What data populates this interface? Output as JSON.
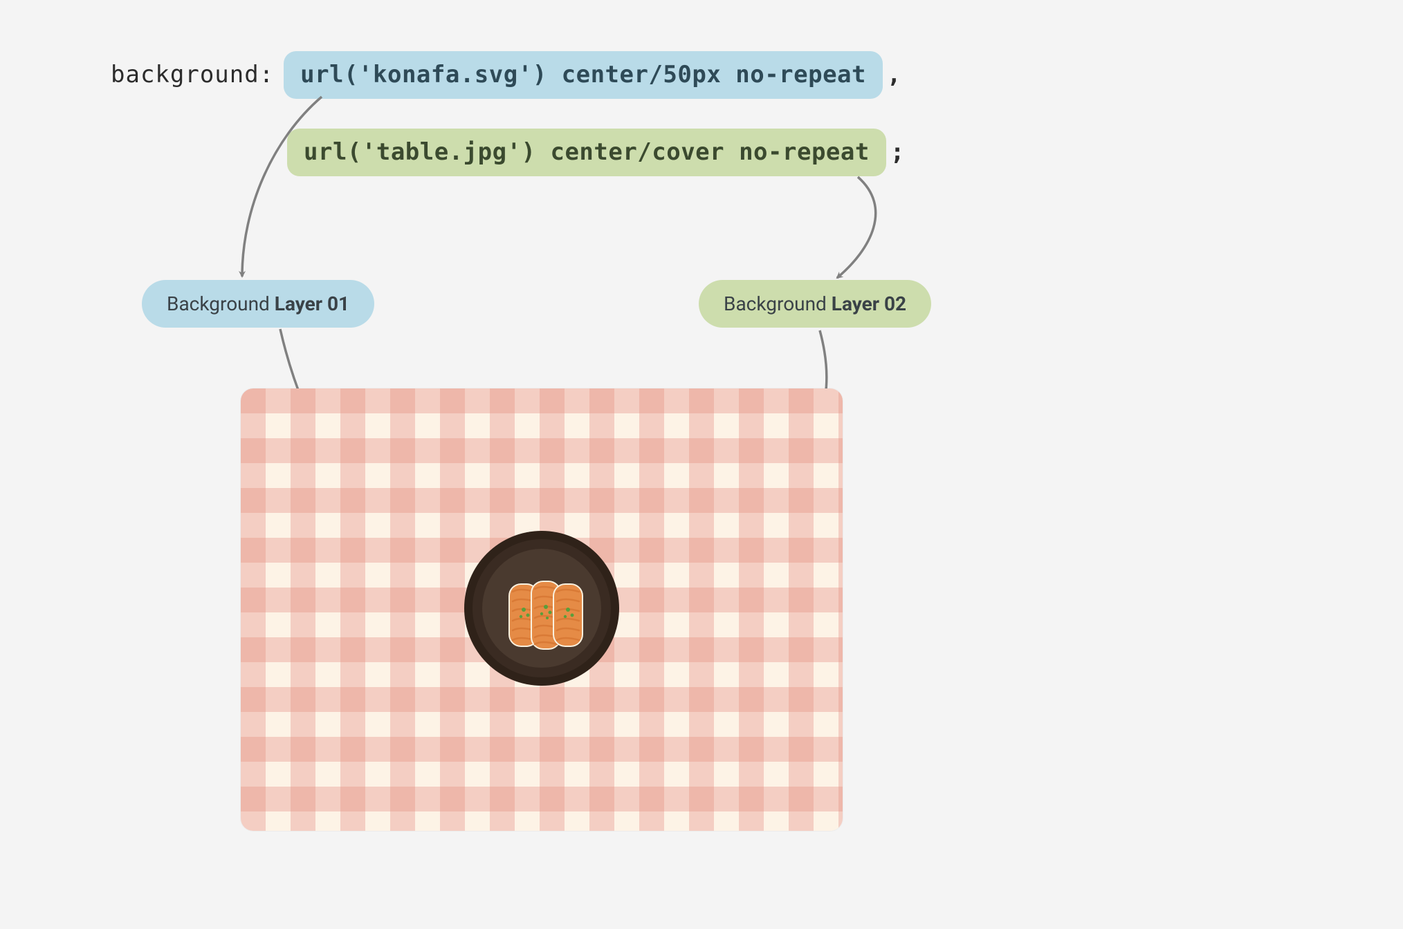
{
  "code": {
    "property": "background:",
    "layer1_value": "url('konafa.svg') center/50px no-repeat",
    "layer1_suffix": ",",
    "layer2_value": "url('table.jpg') center/cover no-repeat",
    "layer2_suffix": ";"
  },
  "labels": {
    "layer1_prefix": "Background ",
    "layer1_bold": "Layer 01",
    "layer2_prefix": "Background ",
    "layer2_bold": "Layer 02"
  },
  "colors": {
    "blue_pill": "#b9dbe8",
    "green_pill": "#cdddad",
    "text_dark": "#344652",
    "page_bg": "#f4f4f4",
    "arrow": "#808080",
    "tablecloth_light": "#fdf3e6",
    "tablecloth_pink_light": "#f4cec3",
    "tablecloth_pink_dark": "#eeb7aa",
    "plate_outer": "#3a2b22",
    "plate_inner": "#4a3a2f",
    "konafa": "#e58b46",
    "konafa_stripe": "#d97a36",
    "garnish": "#5a9e3b"
  },
  "diagram": {
    "layer1_asset": "konafa.svg",
    "layer2_asset": "table.jpg",
    "layer1_target": "plate-with-konafa",
    "layer2_target": "tablecloth"
  }
}
